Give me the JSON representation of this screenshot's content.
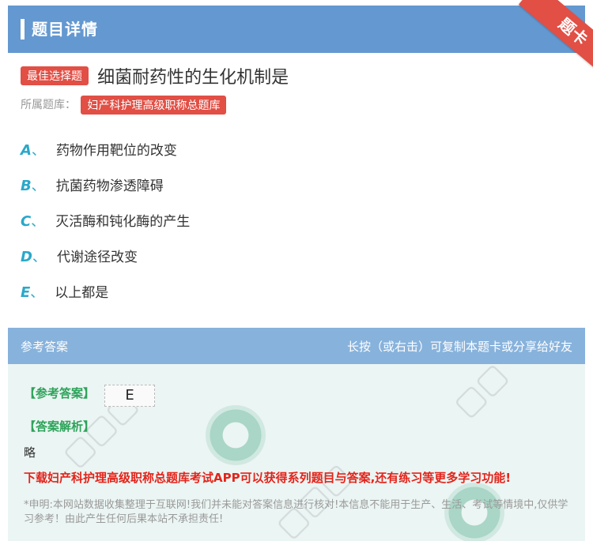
{
  "header": {
    "title": "题目详情",
    "ribbon": "题卡"
  },
  "question": {
    "type_tag": "最佳选择题",
    "text": "细菌耐药性的生化机制是",
    "bank_label": "所属题库：",
    "bank_name": "妇产科护理高级职称总题库"
  },
  "options": [
    {
      "letter": "A",
      "sep": "、",
      "text": "药物作用靶位的改变"
    },
    {
      "letter": "B",
      "sep": "、",
      "text": "抗菌药物渗透障碍"
    },
    {
      "letter": "C",
      "sep": "、",
      "text": "灭活酶和钝化酶的产生"
    },
    {
      "letter": "D",
      "sep": "、",
      "text": "代谢途径改变"
    },
    {
      "letter": "E",
      "sep": "、",
      "text": "以上都是"
    }
  ],
  "answer": {
    "head_left": "参考答案",
    "head_right": "长按（或右击）可复制本题卡或分享给好友",
    "answer_label": "【参考答案】",
    "answer_value": "E",
    "analysis_label": "【答案解析】",
    "analysis_text": "略",
    "download_text": "下载妇产科护理高级职称总题库考试APP可以获得系列题目与答案,还有练习等更多学习功能!",
    "disclaimer": "*申明:本网站数据收集整理于互联网!我们并未能对答案信息进行核对!本信息不能用于生产、生活、考试等情境中,仅供学习参考！由此产生任何后果本站不承担责任!"
  },
  "colors": {
    "header_bg": "#6498d0",
    "tag_red": "#e14f45",
    "option_letter": "#2aa8c9",
    "answer_green": "#2da35a",
    "download_red": "#e3241b"
  }
}
